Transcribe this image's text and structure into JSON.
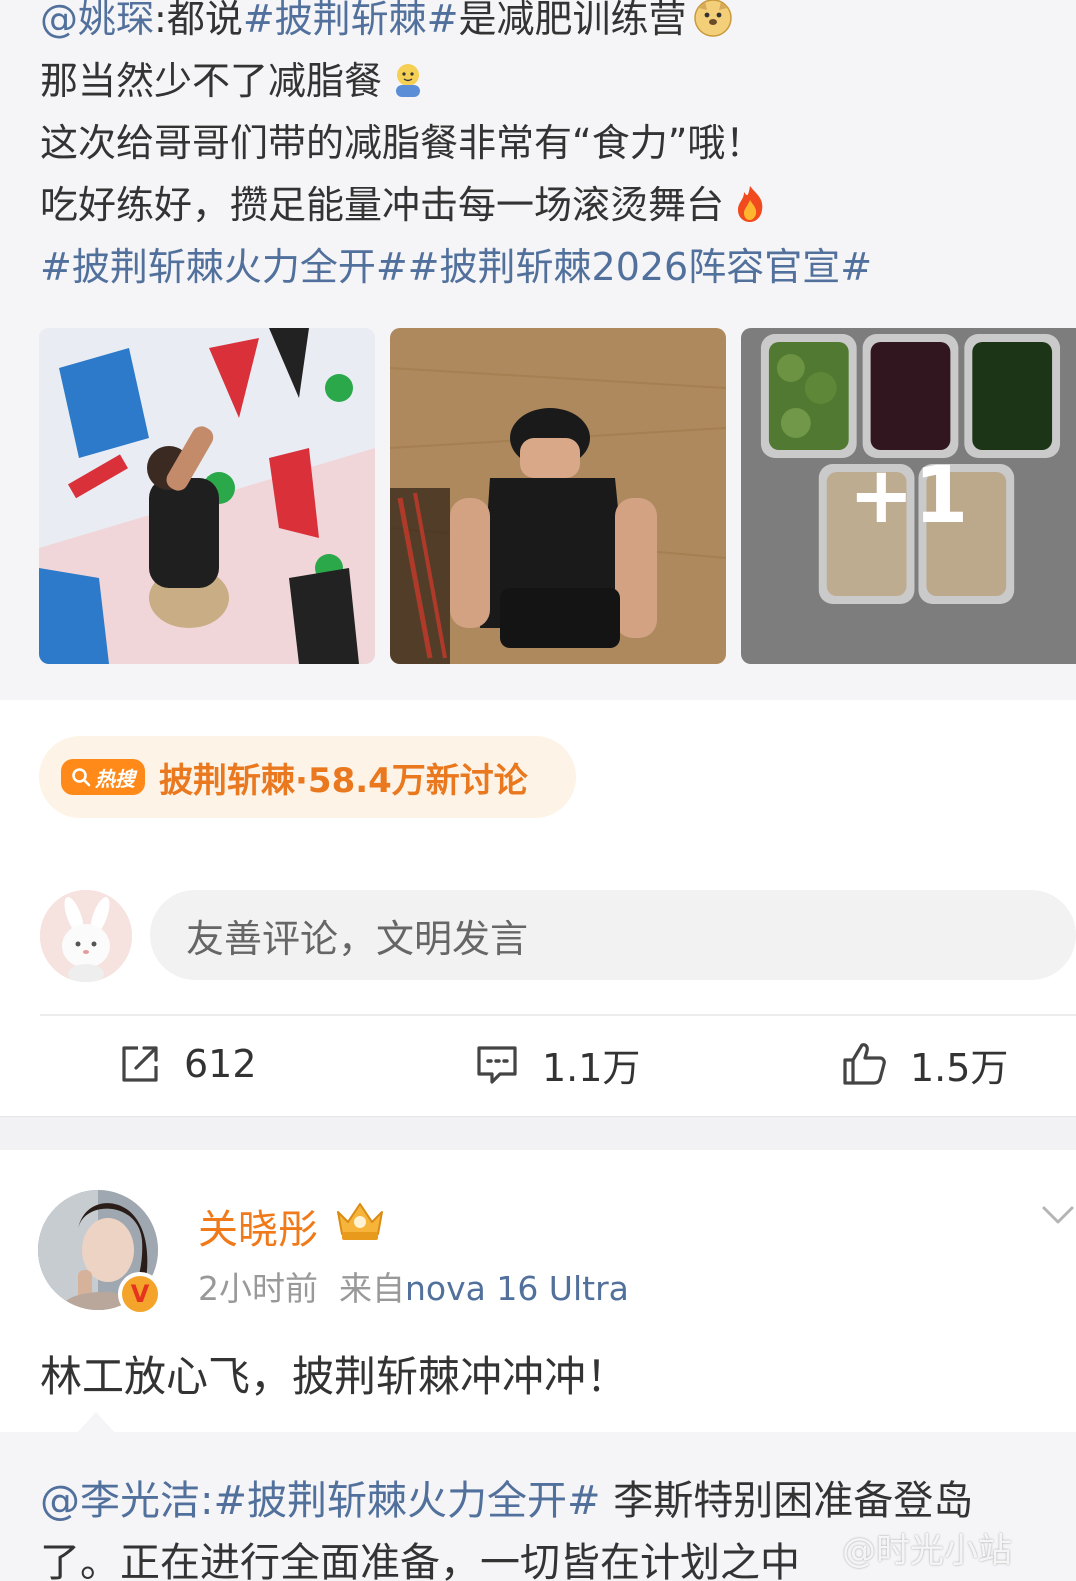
{
  "repost": {
    "line1_mention": "@姚琛",
    "line1_sep": ":都说",
    "line1_tag": "#披荆斩棘#",
    "line1_rest": "是减肥训练营",
    "line2": "那当然少不了减脂餐",
    "line3": "这次给哥哥们带的减脂餐非常有“食力”哦！",
    "line4": "吃好练好，攒足能量冲击每一场滚烫舞台",
    "line5_tags": "#披荆斩棘火力全开##披荆斩棘2026阵容官宣#",
    "emojis": [
      "doge-emoji",
      "praying-emoji",
      "fire-emoji"
    ],
    "images": [
      "climbing-wall-photo",
      "gym-crouch-photo",
      "meal-prep-photo"
    ],
    "more_images": "+1"
  },
  "hot_search": {
    "badge": "热搜",
    "text": "披荆斩棘·58.4万新讨论"
  },
  "comment": {
    "placeholder": "友善评论，文明发言"
  },
  "actions": {
    "repost_count": "612",
    "comment_count": "1.1万",
    "like_count": "1.5万"
  },
  "next_post": {
    "author": "关晓彤",
    "time": "2小时前",
    "from_label": "来自",
    "device": "nova 16 Ultra",
    "body": "林工放心飞，披荆斩棘冲冲冲！",
    "quote_mention": "@李光洁",
    "quote_tag": ":#披荆斩棘火力全开#",
    "quote_rest": " 李斯特别困准备登岛",
    "quote_line2": "了。正在进行全面准备，一切皆在计划之中"
  },
  "watermark": "@时光小站"
}
